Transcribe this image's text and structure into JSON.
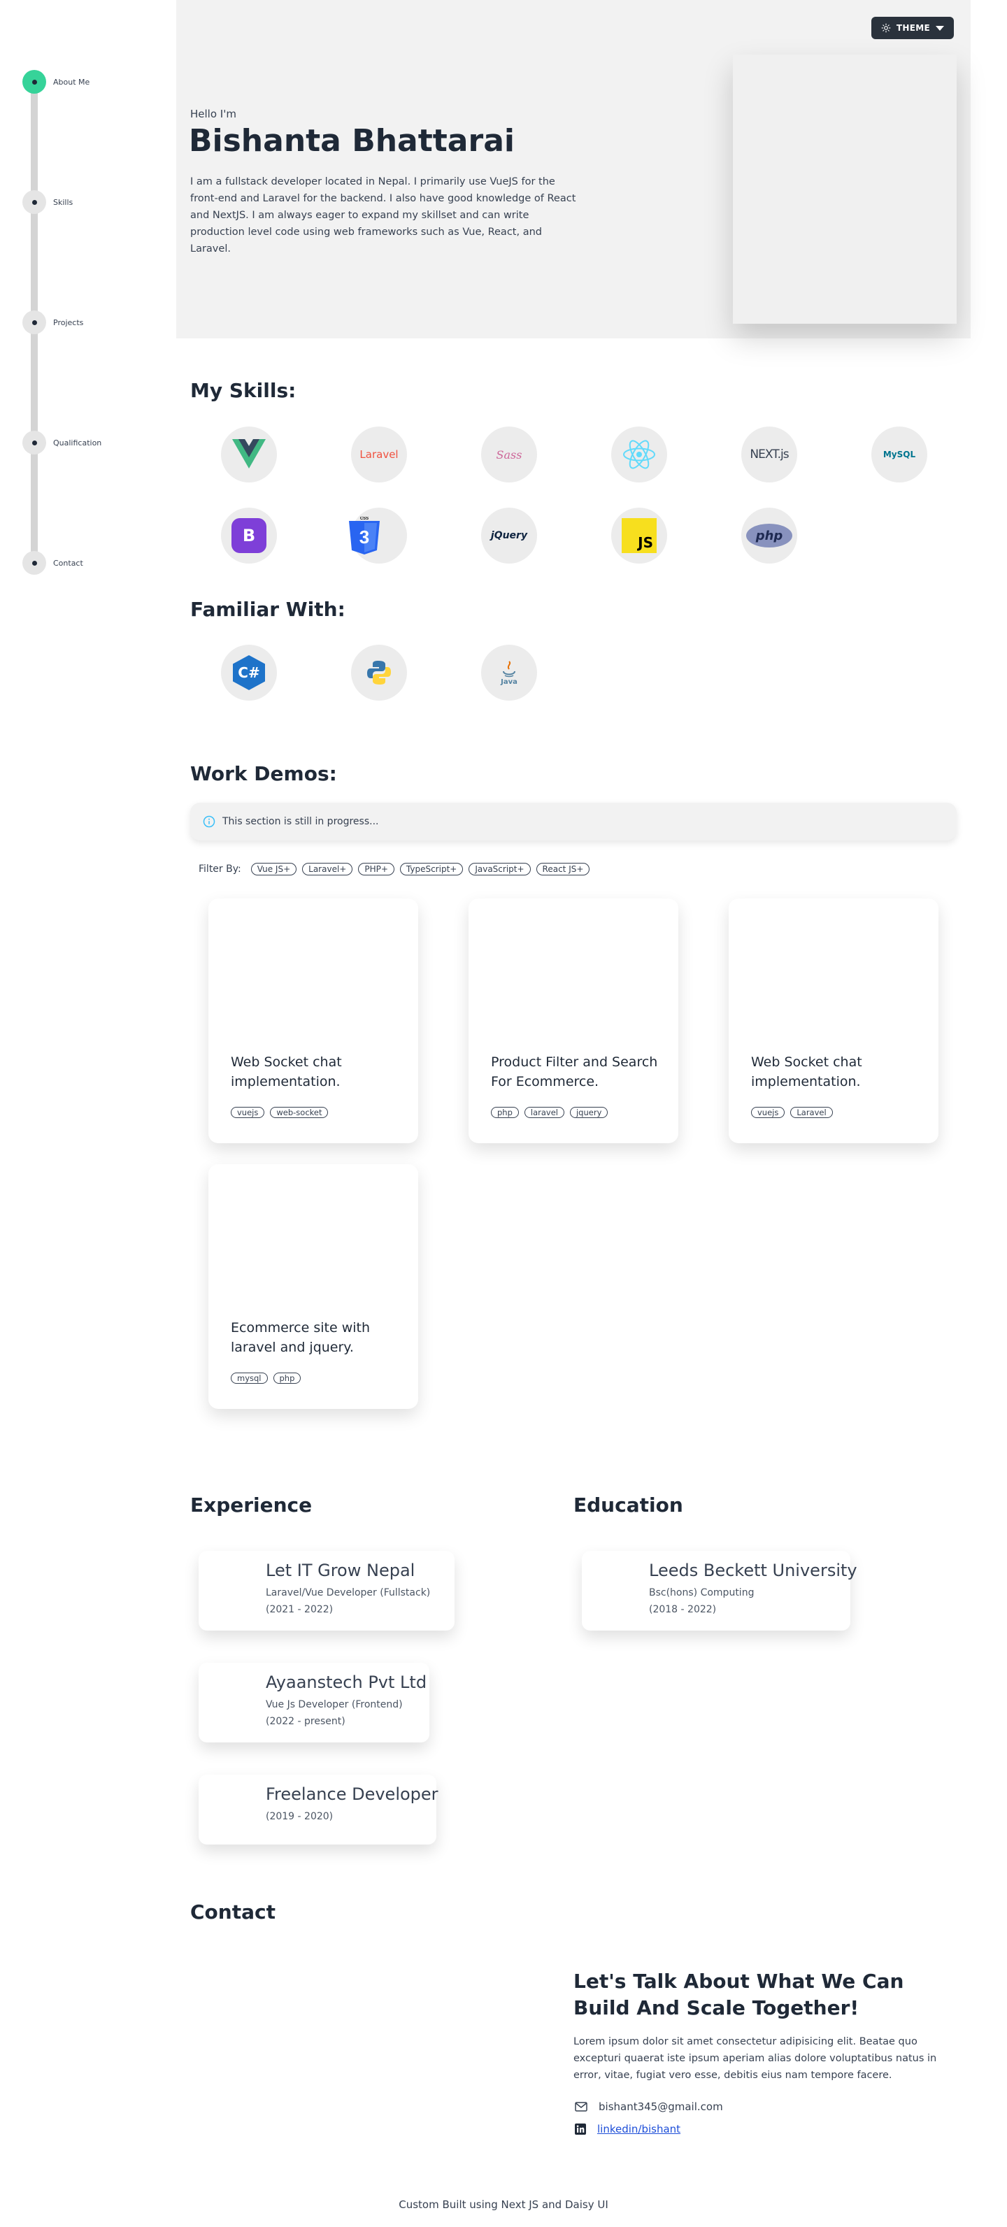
{
  "theme_button": {
    "label": "THEME"
  },
  "nav": [
    {
      "label": "About Me",
      "active": true
    },
    {
      "label": "Skills",
      "active": false
    },
    {
      "label": "Projects",
      "active": false
    },
    {
      "label": "Qualification",
      "active": false
    },
    {
      "label": "Contact",
      "active": false
    }
  ],
  "hero": {
    "greeting": "Hello I'm",
    "name": "Bishanta Bhattarai",
    "bio": "I am a fullstack developer located in Nepal. I primarily use VueJS for the front-end and Laravel for the backend. I also have good knowledge of React and NextJS. I am always eager to expand my skillset and can write production level code using web frameworks such as Vue, React, and Laravel."
  },
  "skills": {
    "title": "My Skills:",
    "items": [
      {
        "icon": "vue-icon"
      },
      {
        "icon": "laravel-icon",
        "text": "Laravel"
      },
      {
        "icon": "sass-icon",
        "text": "Sass"
      },
      {
        "icon": "react-icon"
      },
      {
        "icon": "nextjs-icon",
        "text": "NEXT.js"
      },
      {
        "icon": "mysql-icon",
        "text": "MySQL"
      },
      {
        "icon": "bootstrap-icon",
        "text": "B"
      },
      {
        "icon": "css3-icon",
        "text": "CSS"
      },
      {
        "icon": "jquery-icon",
        "text": "jQuery"
      },
      {
        "icon": "javascript-icon",
        "text": "JS"
      },
      {
        "icon": "php-icon",
        "text": "php"
      }
    ]
  },
  "familiar": {
    "title": "Familiar With:",
    "items": [
      {
        "icon": "csharp-icon",
        "text": "C#"
      },
      {
        "icon": "python-icon"
      },
      {
        "icon": "java-icon",
        "text": "Java"
      }
    ]
  },
  "work": {
    "title": "Work Demos:",
    "alert": "This section is still in progress...",
    "filter_label": "Filter By:",
    "filters": [
      "Vue JS+",
      "Laravel+",
      "PHP+",
      "TypeScript+",
      "JavaScript+",
      "React JS+"
    ],
    "projects": [
      {
        "title": "Web Socket chat implementation.",
        "tags": [
          "vuejs",
          "web-socket"
        ]
      },
      {
        "title": "Product Filter and Search For Ecommerce.",
        "tags": [
          "php",
          "laravel",
          "jquery"
        ]
      },
      {
        "title": "Web Socket chat implementation.",
        "tags": [
          "vuejs",
          "Laravel"
        ]
      },
      {
        "title": "Ecommerce site with laravel and jquery.",
        "tags": [
          "mysql",
          "php"
        ]
      }
    ]
  },
  "experience": {
    "title": "Experience",
    "items": [
      {
        "name": "Let IT Grow Nepal",
        "role": "Laravel/Vue Developer (Fullstack)",
        "period": "(2021 - 2022)"
      },
      {
        "name": "Ayaanstech Pvt Ltd",
        "role": "Vue Js Developer (Frontend)",
        "period": "(2022 - present)"
      },
      {
        "name": "Freelance Developer",
        "period": "(2019 - 2020)"
      }
    ]
  },
  "education": {
    "title": "Education",
    "items": [
      {
        "name": "Leeds Beckett University",
        "role": "Bsc(hons) Computing",
        "period": "(2018 - 2022)"
      }
    ]
  },
  "contact": {
    "title": "Contact",
    "cta_title": "Let's Talk About What We Can Build And Scale Together!",
    "cta_text": "Lorem ipsum dolor sit amet consectetur adipisicing elit. Beatae quo excepturi quaerat iste ipsum aperiam alias dolore voluptatibus natus in error, vitae, fugiat vero esse, debitis eius nam tempore facere.",
    "email": "bishant345@gmail.com",
    "linkedin": "linkedin/bishant"
  },
  "footer": "Custom Built using Next JS and Daisy UI"
}
